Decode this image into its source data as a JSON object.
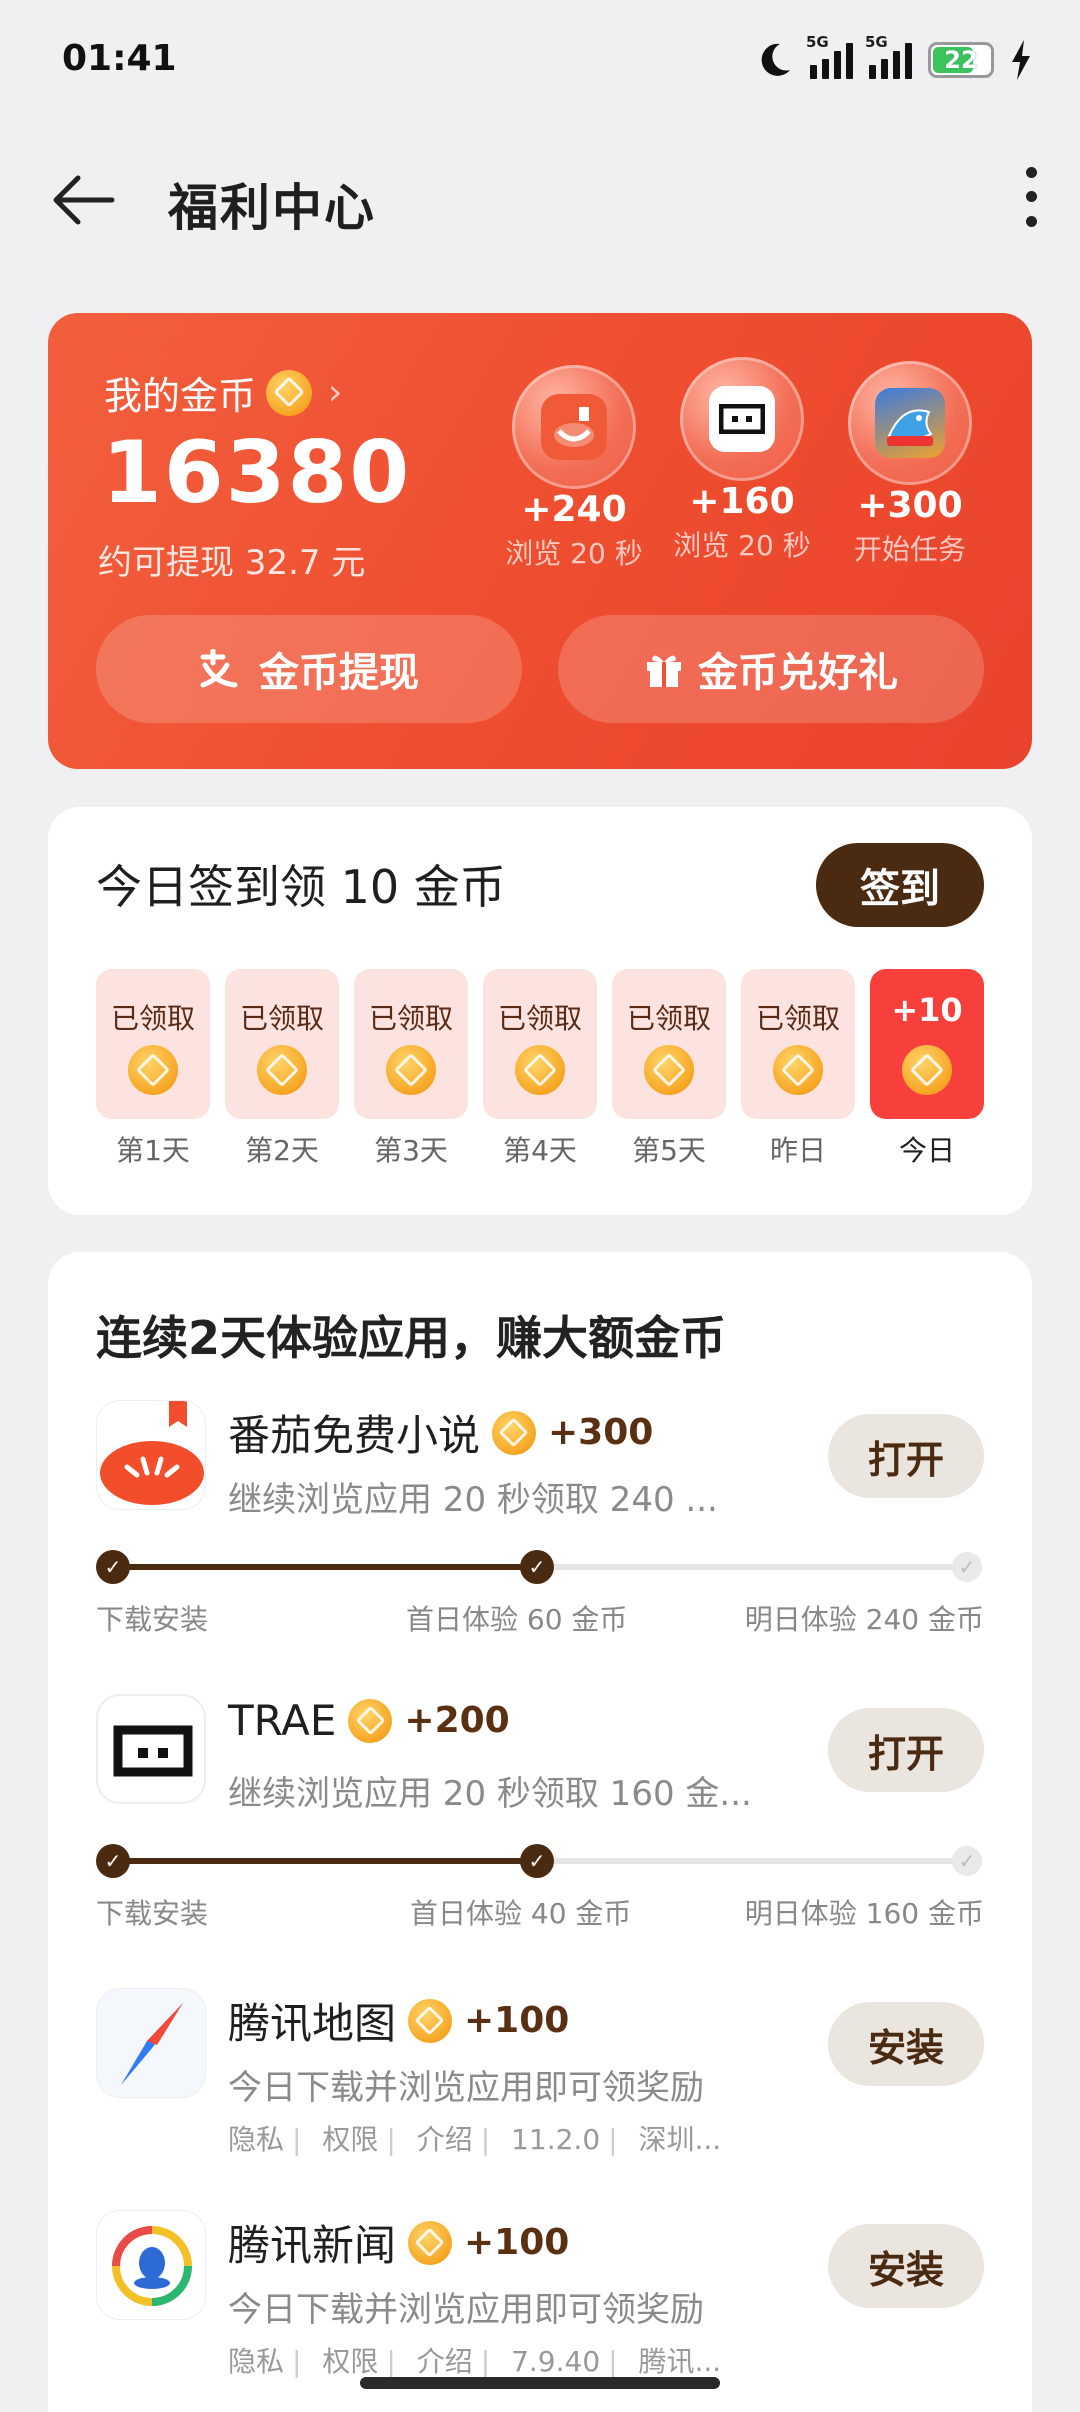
{
  "status_bar": {
    "time": "01:41",
    "net1": "5G",
    "net2": "5G",
    "battery": "22"
  },
  "header": {
    "title": "福利中心"
  },
  "coins": {
    "label": "我的金币",
    "balance": "16380",
    "cash_estimate": "约可提现 32.7 元",
    "bubbles": [
      {
        "amount": "+240",
        "desc": "浏览 20 秒"
      },
      {
        "amount": "+160",
        "desc": "浏览 20 秒"
      },
      {
        "amount": "+300",
        "desc": "开始任务"
      }
    ],
    "withdraw_label": "金币提现",
    "exchange_label": "金币兑好礼"
  },
  "signin": {
    "title": "今日签到领 10 金币",
    "button": "签到",
    "days": [
      {
        "top": "已领取",
        "label": "第1天"
      },
      {
        "top": "已领取",
        "label": "第2天"
      },
      {
        "top": "已领取",
        "label": "第3天"
      },
      {
        "top": "已领取",
        "label": "第4天"
      },
      {
        "top": "已领取",
        "label": "第5天"
      },
      {
        "top": "已领取",
        "label": "昨日"
      },
      {
        "top": "+10",
        "label": "今日"
      }
    ]
  },
  "tasks": {
    "title": "连续2天体验应用，赚大额金币",
    "items": [
      {
        "name": "番茄免费小说",
        "reward": "+300",
        "desc": "继续浏览应用 20 秒领取 240 ...",
        "button": "打开",
        "progress": {
          "steps": [
            "下载安装",
            "首日体验 60 金币",
            "明日体验 240 金币"
          ],
          "completed_steps": 2
        }
      },
      {
        "name": "TRAE",
        "reward": "+200",
        "desc": "继续浏览应用 20 秒领取 160 金...",
        "button": "打开",
        "progress": {
          "steps": [
            "下载安装",
            "首日体验 40 金币",
            "明日体验 160 金币"
          ],
          "completed_steps": 2
        }
      },
      {
        "name": "腾讯地图",
        "reward": "+100",
        "desc": "今日下载并浏览应用即可领奖励",
        "button": "安装",
        "meta": [
          "隐私",
          "权限",
          "介绍",
          "11.2.0",
          "深圳..."
        ]
      },
      {
        "name": "腾讯新闻",
        "reward": "+100",
        "desc": "今日下载并浏览应用即可领奖励",
        "button": "安装",
        "meta": [
          "隐私",
          "权限",
          "介绍",
          "7.9.40",
          "腾讯..."
        ]
      }
    ]
  }
}
